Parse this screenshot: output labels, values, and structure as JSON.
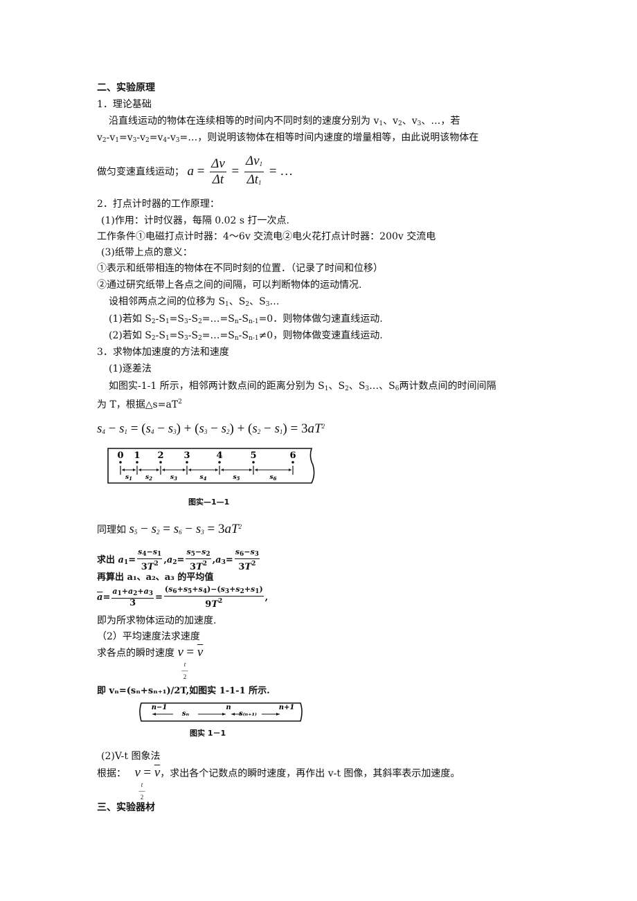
{
  "section2": {
    "title": "二、实验原理",
    "p1_heading": "1．理论基础",
    "p1_line1_a": "沿直线运动的物体在连续相等的时间内不同时刻的速度分别为 v",
    "p1_line1_b": "、v",
    "p1_line1_c": "、v",
    "p1_line1_d": "、…，若",
    "p1_line2_tail": "，则说明该物体在相等时间内速度的增量相等，由此说明该物体在",
    "p1_line3": "做匀变速直线运动；",
    "formula_a": "a",
    "formula_dv": "Δv",
    "formula_dt": "Δt",
    "formula_dv1": "Δv",
    "formula_dt1": "Δt",
    "formula_tail": "= …",
    "p2_heading": "2．打点计时器的工作原理：",
    "p2_item1": "(1)作用：计时仪器，每隔 0.02 s 打一次点.",
    "p2_conditions": "工作条件①电磁打点计时器：4～6v 交流电②电火花打点计时器：200v 交流电",
    "p2_item3": "(3)纸带上点的意义：",
    "p2_point1": "①表示和纸带相连的物体在不同时刻的位置．（记录了时间和位移）",
    "p2_point2": "②通过研究纸带上各点之间的间隔，可以判断物体的运动情况.",
    "p2_disp": "设相邻两点之间的位移为 S",
    "p2_case1_tail": "．则物体做匀速直线运动.",
    "p2_case2_tail": "，则物体做变速直线运动.",
    "p3_heading": "3．求物体加速度的方法和速度",
    "p3_m1": "(1)逐差法",
    "p3_m1_text1_a": "如图实-1-1 所示，相邻两计数点间的距离分别为 S",
    "p3_m1_text1_b": "两计数点间的时间间隔",
    "p3_m1_text2": "为 T，根据△s=aT",
    "eq1": "s₄ − s₁ = (s₄ − s₃) + (s₃ − s₂) + (s₂ − s₁) = 3aT²",
    "fig1_caption": "图实—1—1",
    "fig1_points": [
      "0",
      "1",
      "2",
      "3",
      "4",
      "5",
      "6"
    ],
    "fig1_segments": [
      "s1",
      "s2",
      "s3",
      "s4",
      "s5",
      "s6"
    ],
    "eq2_prefix": "同理如",
    "eq2": "s₅ − s₂ = s₆ − s₃ = 3aT²",
    "eq3_prefix": "求出",
    "eq4_text": "再算出 a₁、a₂、a₃ 的平均值",
    "conclusion": "即为所求物体运动的加速度.",
    "p3_m2": "（2）平均速度法求速度",
    "p3_m2_text": "求各点的瞬时速度",
    "vn_eq": "即 vₙ=(sₙ+sₙ₊₁)/2T,如图实 1-1-1 所示.",
    "fig2_caption": "图实 1－1",
    "fig2_labels": [
      "n−1",
      "sₙ",
      "n",
      "s₍ₙ₊₁₎",
      "n+1"
    ],
    "p3_m3": "(2)V-t 图象法",
    "p3_m3_text_a": "根据：",
    "p3_m3_text_b": "，求出各个记数点的瞬时速度，再作出 v-t 图像，其斜率表示加速度。"
  },
  "section3": {
    "title": "三、实验器材"
  }
}
